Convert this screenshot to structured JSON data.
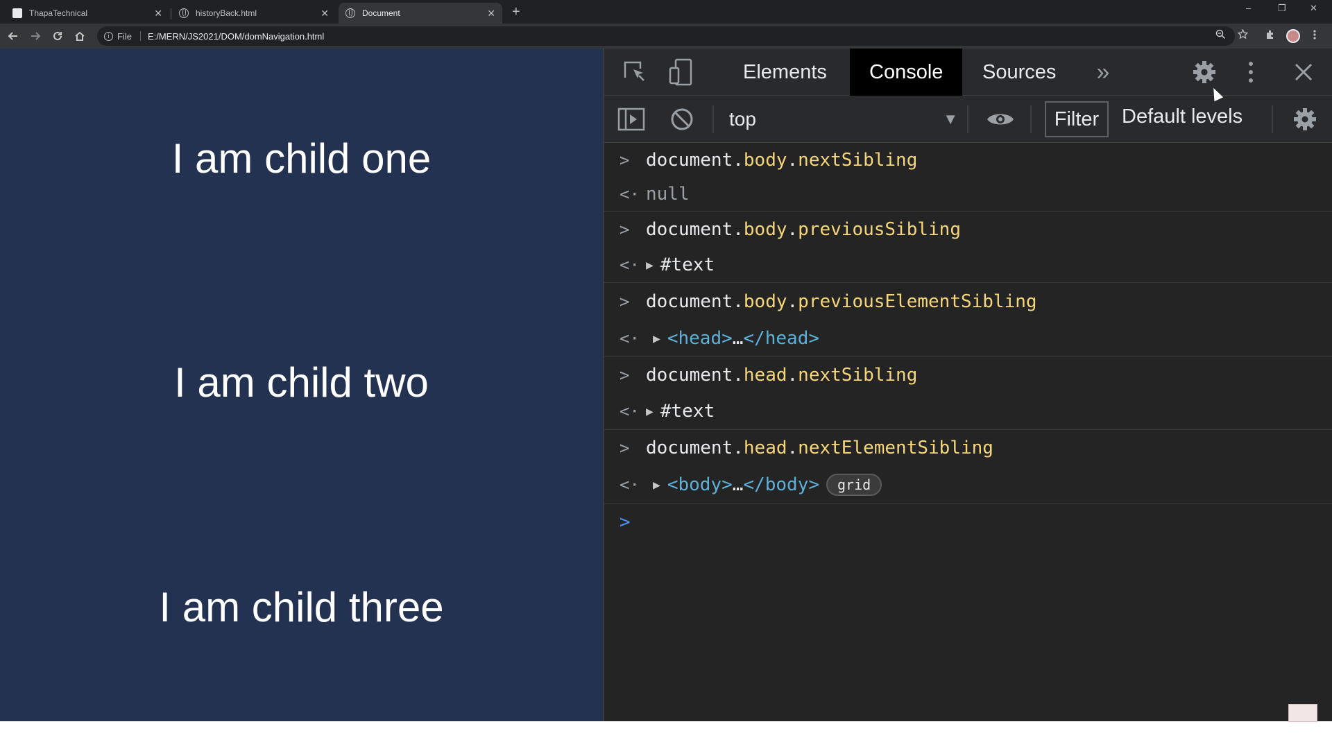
{
  "browser": {
    "tabs": [
      {
        "label": "ThapaTechnical",
        "close": "✕"
      },
      {
        "label": "historyBack.html",
        "close": "✕"
      },
      {
        "label": "Document",
        "close": "✕"
      }
    ],
    "new_tab": "+",
    "window_controls": {
      "minimize": "–",
      "restore": "❐",
      "close": "✕"
    },
    "address": {
      "scheme": "File",
      "url": "E:/MERN/JS2021/DOM/domNavigation.html"
    }
  },
  "page": {
    "children": [
      "I am child one",
      "I am child two",
      "I am child three"
    ],
    "background": "#233250"
  },
  "devtools": {
    "tabs": [
      "Elements",
      "Console",
      "Sources"
    ],
    "active_tab": "Console",
    "more_tabs": "»",
    "context": "top",
    "filter_label": "Filter",
    "levels_label": "Default levels",
    "console": [
      {
        "input": {
          "obj": "document",
          "member": "body",
          "prop": "nextSibling"
        },
        "output": {
          "kind": "null",
          "text": "null"
        }
      },
      {
        "input": {
          "obj": "document",
          "member": "body",
          "prop": "previousSibling"
        },
        "output": {
          "kind": "node",
          "text": "#text"
        }
      },
      {
        "input": {
          "obj": "document",
          "member": "body",
          "prop": "previousElementSibling"
        },
        "output": {
          "kind": "element",
          "open": "<head>",
          "ellipsis": "…",
          "close": "</head>"
        }
      },
      {
        "input": {
          "obj": "document",
          "member": "head",
          "prop": "nextSibling"
        },
        "output": {
          "kind": "node",
          "text": "#text"
        }
      },
      {
        "input": {
          "obj": "document",
          "member": "head",
          "prop": "nextElementSibling"
        },
        "output": {
          "kind": "element",
          "open": "<body>",
          "ellipsis": "…",
          "close": "</body>",
          "badge": "grid"
        }
      }
    ]
  }
}
